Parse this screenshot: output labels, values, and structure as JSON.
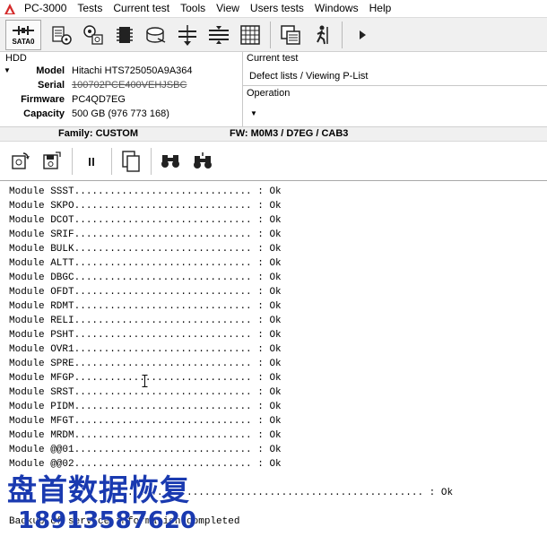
{
  "menu": {
    "app_name": "PC-3000",
    "items": [
      "Tests",
      "Current test",
      "Tools",
      "View",
      "Users tests",
      "Windows",
      "Help"
    ]
  },
  "toolbar": {
    "sata_label": "SATA0",
    "buttons": [
      "heads-map-icon",
      "disk-settings-icon",
      "chip-icon",
      "disk-access-icon",
      "head-stack-icon",
      "platter-stack-icon",
      "grid-table-icon",
      "copy-window-icon",
      "run-man-icon",
      "play-arrow-icon"
    ]
  },
  "hdd": {
    "title": "HDD",
    "rows": [
      {
        "label": "Model",
        "value": "Hitachi HTS725050A9A364"
      },
      {
        "label": "Serial",
        "value": "100702PCE400VEHJSBC"
      },
      {
        "label": "Firmware",
        "value": "PC4QD7EG"
      },
      {
        "label": "Capacity",
        "value": "500 GB (976 773 168)"
      }
    ]
  },
  "current_test": {
    "title": "Current test",
    "value": "Defect lists / Viewing P-List"
  },
  "operation": {
    "title": "Operation"
  },
  "family": {
    "left": "Family: CUSTOM",
    "right": "FW: M0M3 / D7EG / CAB3"
  },
  "log": {
    "lines": [
      "Module SSST.............................. : Ok",
      "Module SKPO.............................. : Ok",
      "Module DCOT.............................. : Ok",
      "Module SRIF.............................. : Ok",
      "Module BULK.............................. : Ok",
      "Module ALTT.............................. : Ok",
      "Module DBGC.............................. : Ok",
      "Module OFDT.............................. : Ok",
      "Module RDMT.............................. : Ok",
      "Module RELI.............................. : Ok",
      "Module PSHT.............................. : Ok",
      "Module OVR1.............................. : Ok",
      "Module SPRE.............................. : Ok",
      "Module MFGP.............................. : Ok",
      "Module SRST.............................. : Ok",
      "Module PIDM.............................. : Ok",
      "Module MFGT.............................. : Ok",
      "Module MRDM.............................. : Ok",
      "Module @@01.............................. : Ok",
      "Module @@02.............................. : Ok"
    ],
    "summary_line": "                 ..................................................... : Ok",
    "final_line": "Backup of service information completed"
  },
  "watermark": {
    "chinese": "盘首数据恢复",
    "phone": "18913587620"
  },
  "colors": {
    "watermark": "#1a3ab0",
    "logo_red": "#d42a2a"
  }
}
